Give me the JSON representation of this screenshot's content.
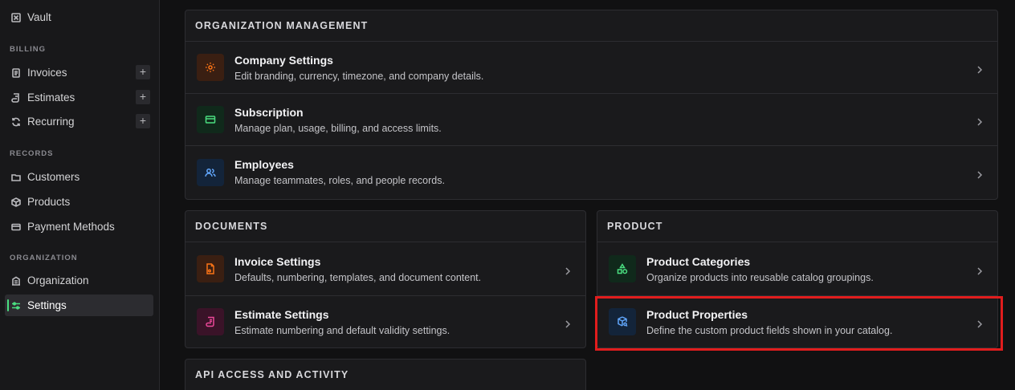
{
  "sidebar": {
    "vault": "Vault",
    "billing_label": "BILLING",
    "invoices": "Invoices",
    "estimates": "Estimates",
    "recurring": "Recurring",
    "plus": "+",
    "records_label": "RECORDS",
    "customers": "Customers",
    "products": "Products",
    "payment_methods": "Payment Methods",
    "organization_label": "ORGANIZATION",
    "organization": "Organization",
    "settings": "Settings"
  },
  "org_mgmt": {
    "heading": "ORGANIZATION MANAGEMENT",
    "items": [
      {
        "title": "Company Settings",
        "desc": "Edit branding, currency, timezone, and company details."
      },
      {
        "title": "Subscription",
        "desc": "Manage plan, usage, billing, and access limits."
      },
      {
        "title": "Employees",
        "desc": "Manage teammates, roles, and people records."
      }
    ]
  },
  "documents": {
    "heading": "DOCUMENTS",
    "items": [
      {
        "title": "Invoice Settings",
        "desc": "Defaults, numbering, templates, and document content."
      },
      {
        "title": "Estimate Settings",
        "desc": "Estimate numbering and default validity settings."
      }
    ]
  },
  "product": {
    "heading": "PRODUCT",
    "items": [
      {
        "title": "Product Categories",
        "desc": "Organize products into reusable catalog groupings."
      },
      {
        "title": "Product Properties",
        "desc": "Define the custom product fields shown in your catalog."
      }
    ]
  },
  "api": {
    "heading": "API ACCESS AND ACTIVITY"
  },
  "colors": {
    "accent": "#4ade80",
    "highlight": "#e11d1d",
    "company_icon": "#f97316",
    "subscription_icon": "#4ade80",
    "employees_icon": "#60a5fa",
    "invoice_icon": "#f97316",
    "estimate_icon": "#ec4899",
    "categories_icon": "#4ade80",
    "properties_icon": "#60a5fa"
  }
}
